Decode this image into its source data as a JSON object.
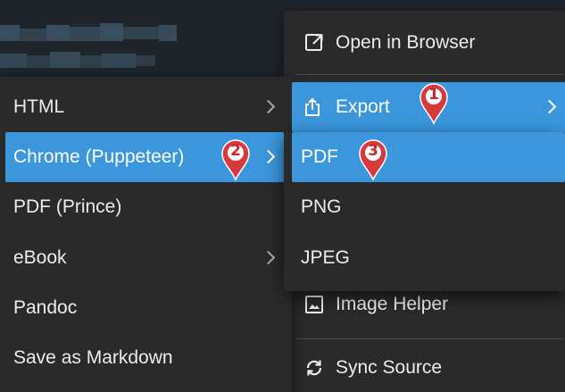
{
  "context_menu": {
    "items": [
      {
        "label": "Open in Browser",
        "icon": "external-link-icon"
      },
      {
        "label": "Export",
        "icon": "share-upload-icon",
        "highlighted": true
      },
      {
        "label": "Image Helper",
        "icon": "image-icon"
      },
      {
        "label": "Sync Source",
        "icon": "sync-icon"
      }
    ]
  },
  "export_menu": {
    "items": [
      {
        "label": "HTML",
        "has_submenu": true
      },
      {
        "label": "Chrome (Puppeteer)",
        "has_submenu": true,
        "highlighted": true
      },
      {
        "label": "PDF (Prince)",
        "has_submenu": false
      },
      {
        "label": "eBook",
        "has_submenu": true
      },
      {
        "label": "Pandoc",
        "has_submenu": false
      },
      {
        "label": "Save as Markdown",
        "has_submenu": false
      }
    ]
  },
  "puppeteer_menu": {
    "items": [
      {
        "label": "PDF",
        "highlighted": true
      },
      {
        "label": "PNG"
      },
      {
        "label": "JPEG"
      }
    ]
  },
  "step_markers": [
    "1",
    "2",
    "3"
  ],
  "colors": {
    "highlight": "#3b96dc",
    "menu_bg": "#2a2a2a",
    "marker_red": "#d63a3a"
  }
}
